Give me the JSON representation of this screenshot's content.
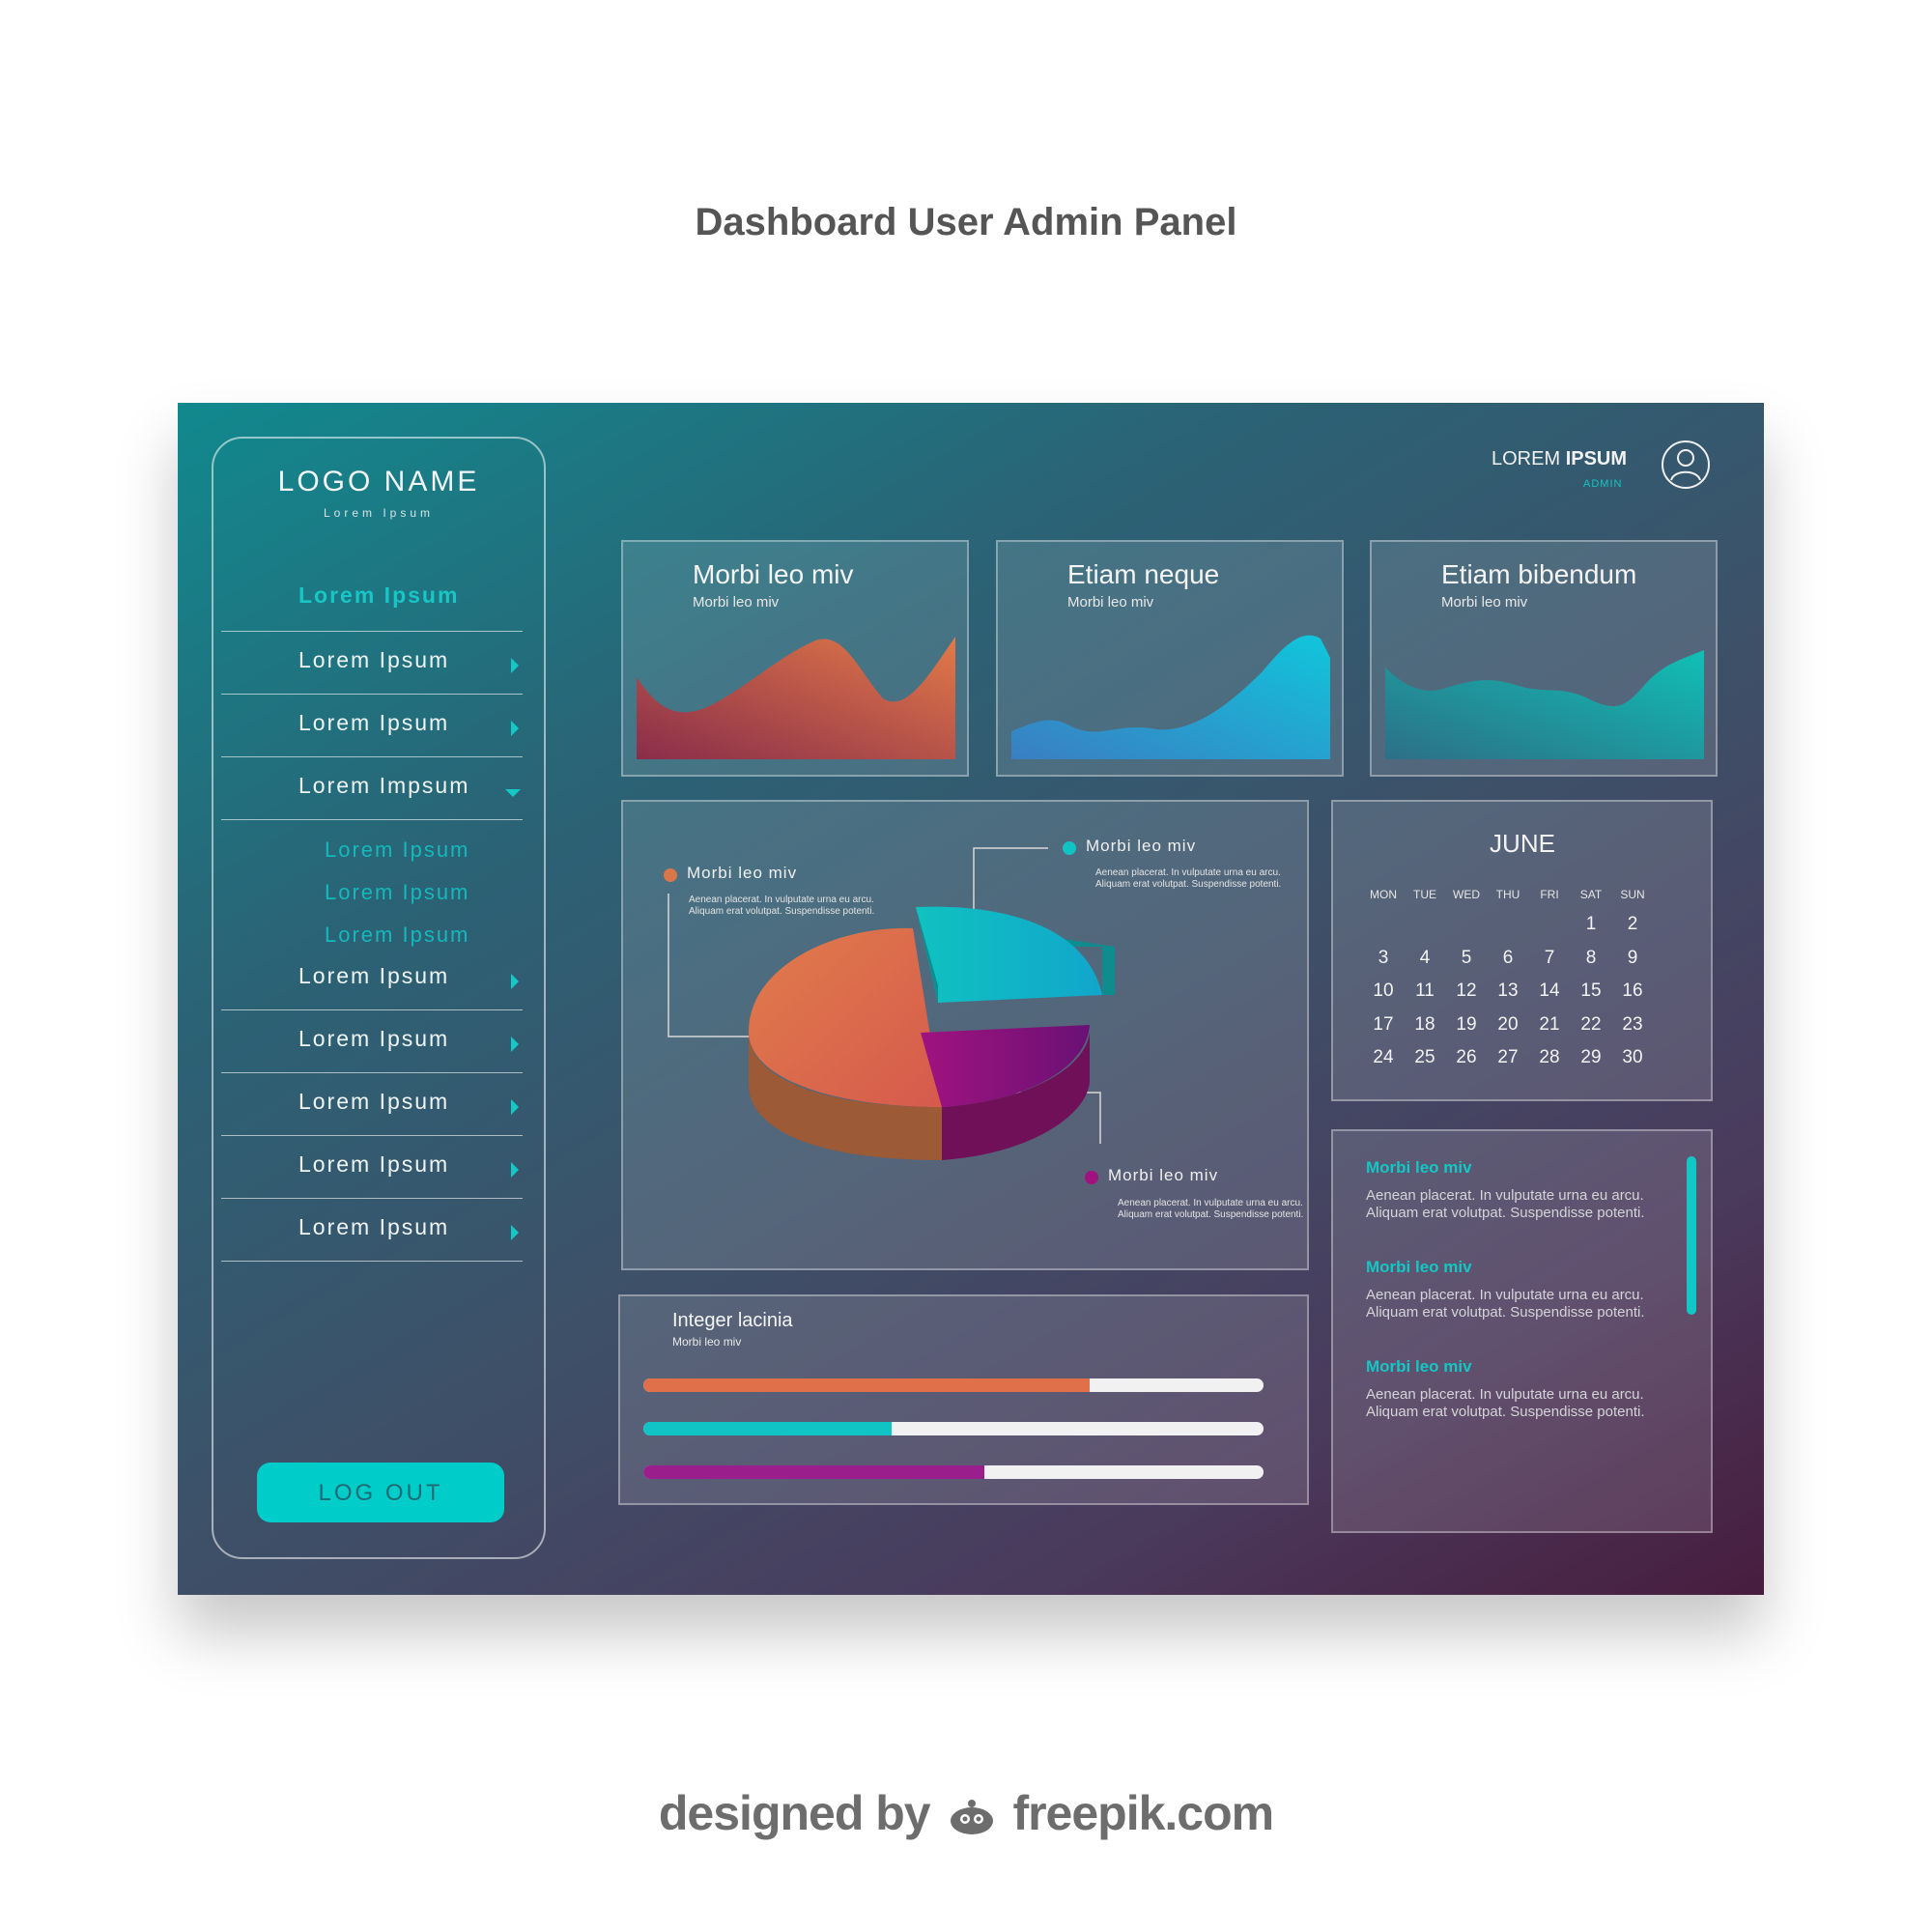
{
  "page_title": "Dashboard User Admin Panel",
  "footer": {
    "prefix": "designed by",
    "brand": "freepik.com"
  },
  "sidebar": {
    "logo_name": "LOGO NAME",
    "logo_sub": "Lorem Ipsum",
    "active_item": "Lorem Ipsum",
    "items": [
      {
        "label": "Lorem Ipsum"
      },
      {
        "label": "Lorem Ipsum"
      },
      {
        "label": "Lorem Impsum"
      },
      {
        "label": "Lorem Ipsum"
      },
      {
        "label": "Lorem Ipsum"
      },
      {
        "label": "Lorem Ipsum"
      },
      {
        "label": "Lorem Ipsum"
      },
      {
        "label": "Lorem Ipsum"
      }
    ],
    "sub_items": [
      {
        "label": "Lorem Ipsum"
      },
      {
        "label": "Lorem Ipsum"
      },
      {
        "label": "Lorem Ipsum"
      }
    ],
    "logout_label": "LOG OUT"
  },
  "user": {
    "name_light": "LOREM",
    "name_bold": "IPSUM",
    "role": "ADMIN",
    "icon": "user-icon"
  },
  "cards": [
    {
      "title": "Morbi leo miv",
      "subtitle": "Morbi leo miv"
    },
    {
      "title": "Etiam neque",
      "subtitle": "Morbi leo miv"
    },
    {
      "title": "Etiam bibendum",
      "subtitle": "Morbi leo miv"
    }
  ],
  "pie": {
    "legend": [
      {
        "label": "Morbi leo miv",
        "text": "Aenean placerat. In vulputate urna eu arcu. Aliquam erat volutpat. Suspendisse potenti.",
        "color": "#d9774a"
      },
      {
        "label": "Morbi leo miv",
        "text": "Aenean placerat. In vulputate urna eu arcu. Aliquam erat volutpat. Suspendisse potenti.",
        "color": "#10c3c4"
      },
      {
        "label": "Morbi leo miv",
        "text": "Aenean placerat. In vulputate urna eu arcu. Aliquam erat volutpat. Suspendisse potenti.",
        "color": "#a0127f"
      }
    ]
  },
  "calendar": {
    "month": "JUNE",
    "dow": [
      "MON",
      "TUE",
      "WED",
      "THU",
      "FRI",
      "SAT",
      "SUN"
    ],
    "weeks": [
      [
        "",
        "",
        "",
        "",
        "",
        "1",
        "2"
      ],
      [
        "3",
        "4",
        "5",
        "6",
        "7",
        "8",
        "9"
      ],
      [
        "10",
        "11",
        "12",
        "13",
        "14",
        "15",
        "16"
      ],
      [
        "17",
        "18",
        "19",
        "20",
        "21",
        "22",
        "23"
      ],
      [
        "24",
        "25",
        "26",
        "27",
        "28",
        "29",
        "30"
      ]
    ]
  },
  "messages": [
    {
      "title": "Morbi leo miv",
      "text": "Aenean placerat. In vulputate urna eu arcu. Aliquam erat volutpat. Suspendisse potenti."
    },
    {
      "title": "Morbi leo miv",
      "text": "Aenean placerat. In vulputate urna eu arcu. Aliquam erat volutpat. Suspendisse potenti."
    },
    {
      "title": "Morbi leo miv",
      "text": "Aenean placerat. In vulputate urna eu arcu. Aliquam erat volutpat. Suspendisse potenti."
    }
  ],
  "progress": {
    "title": "Integer lacinia",
    "subtitle": "Morbi leo miv",
    "bars": [
      {
        "value": 0.72,
        "color": "#e0704a"
      },
      {
        "value": 0.4,
        "color": "#10c3c4"
      },
      {
        "value": 0.55,
        "color": "#9a1f8c"
      }
    ]
  },
  "colors": {
    "accent": "#00cdc9",
    "title_gray": "#555555"
  }
}
